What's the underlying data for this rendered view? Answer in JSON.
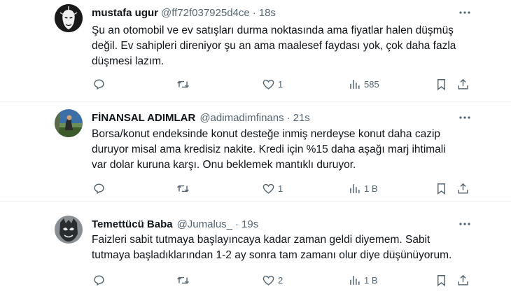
{
  "tweets": [
    {
      "name": "mustafa ugur",
      "handle": "@ff72f037925d4ce",
      "separator": "·",
      "time": "18s",
      "lines": [
        "Şu an otomobil ve ev satışları durma noktasında ama fiyatlar halen düşmüş",
        "değil. Ev sahipleri direniyor şu an ama maalesef faydası yok, çok daha fazla",
        "düşmesi lazım."
      ],
      "likes": "1",
      "views": "585",
      "avatar": "bw-mask-avatar"
    },
    {
      "name": "FİNANSAL ADIMLAR",
      "handle": "@adimadimfinans",
      "separator": "·",
      "time": "21s",
      "lines": [
        "Borsa/konut endeksinde konut desteğe inmiş nerdeyse konut daha cazip",
        "duruyor misal ama kredisiz nakite. Kredi için %15 daha aşağı marj ihtimali",
        "var dolar kuruna karşı. Onu beklemek mantıklı duruyor."
      ],
      "likes": "1",
      "views": "1 B",
      "avatar": "photo-avatar"
    },
    {
      "name": "Temettücü Baba",
      "handle": "@Jumalus_",
      "separator": "·",
      "time": "19s",
      "lines": [
        "Faizleri sabit tutmaya başlayıncaya kadar zaman geldi diyemem. Sabit",
        "tutmaya başladıklarından 1-2 ay sonra tam zamanı olur diye düşünüyorum."
      ],
      "likes": "2",
      "views": "1 B",
      "avatar": "mask-avatar"
    }
  ],
  "icons": {
    "reply": "reply-icon",
    "retweet": "retweet-icon",
    "like": "heart-icon",
    "views": "views-icon",
    "bookmark": "bookmark-icon",
    "share": "share-icon",
    "more": "more-icon"
  },
  "colors": {
    "text": "#0f1419",
    "secondary": "#536471",
    "divider": "#eff3f4"
  }
}
